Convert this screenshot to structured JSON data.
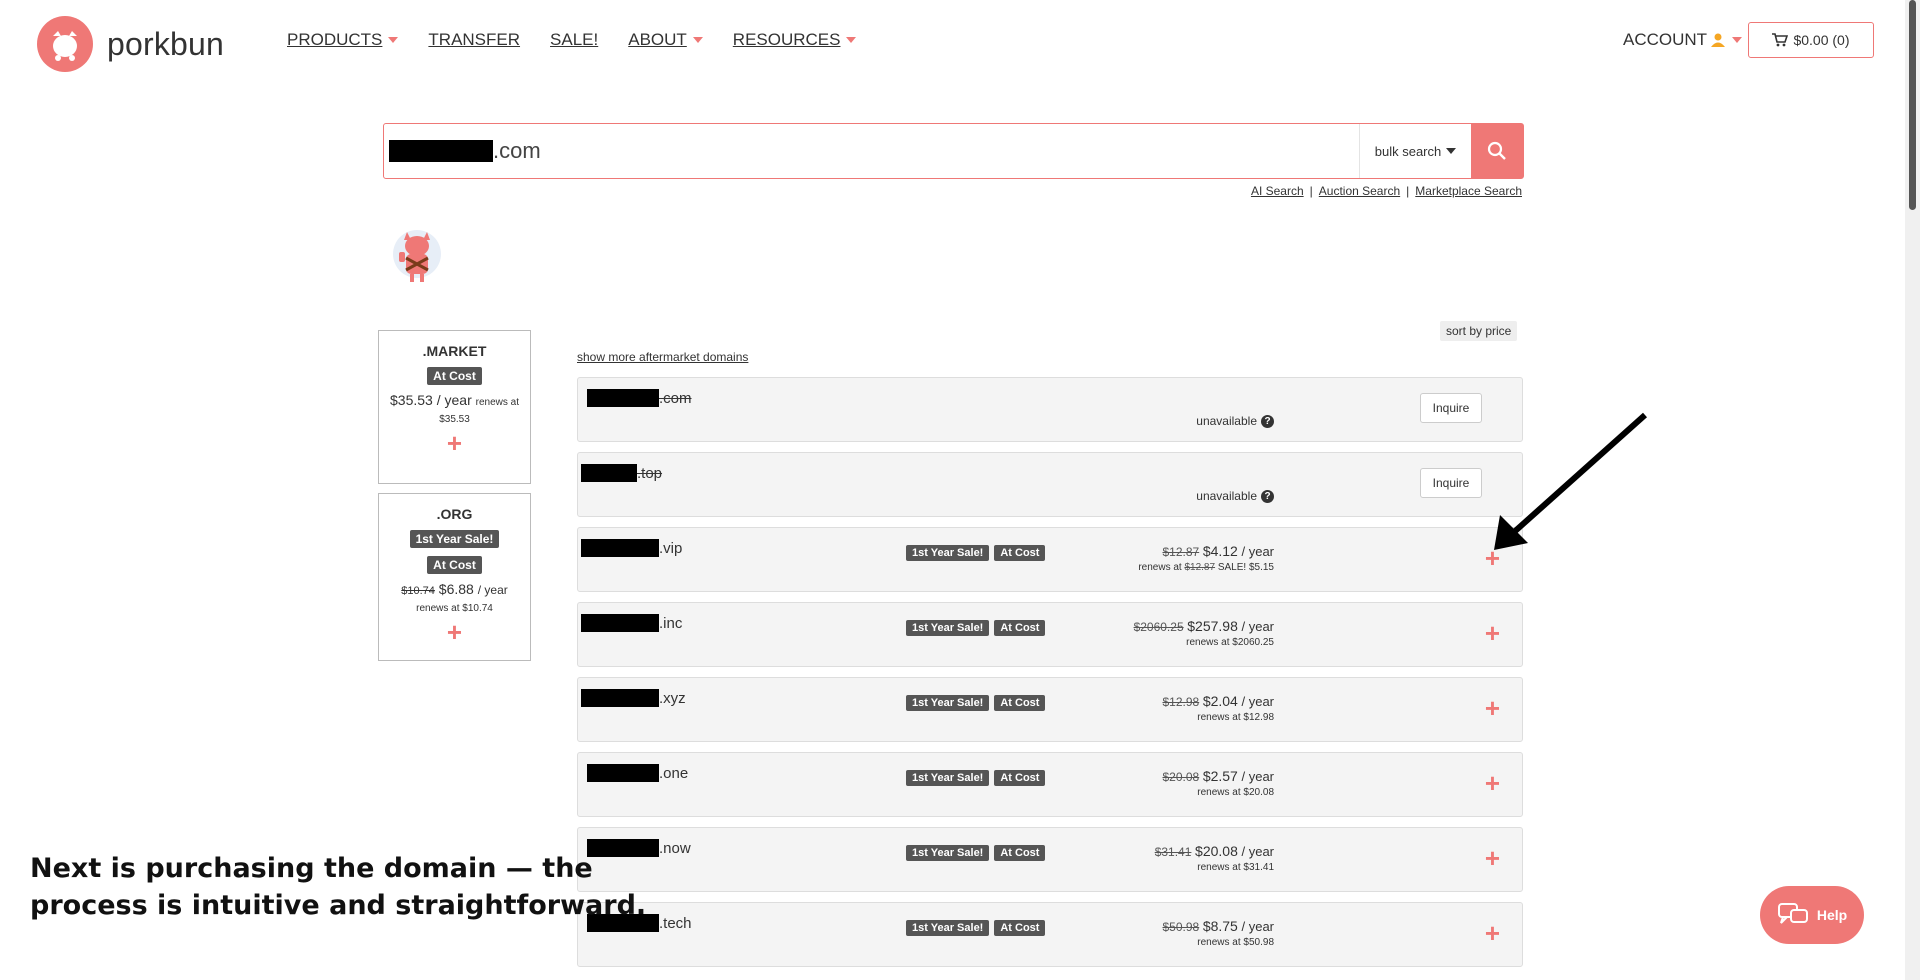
{
  "header": {
    "brand": "porkbun",
    "nav": [
      {
        "label": "PRODUCTS",
        "dropdown": true
      },
      {
        "label": "TRANSFER",
        "dropdown": false
      },
      {
        "label": "SALE!",
        "dropdown": false
      },
      {
        "label": "ABOUT",
        "dropdown": true
      },
      {
        "label": "RESOURCES",
        "dropdown": true
      }
    ],
    "account": "ACCOUNT",
    "cart": "$0.00 (0)"
  },
  "search": {
    "value_suffix": ".com",
    "bulk_label": "bulk search",
    "links": [
      "AI Search",
      "Auction Search",
      "Marketplace Search"
    ]
  },
  "sidebar": [
    {
      "tld": ".MARKET",
      "badges": [
        "At Cost"
      ],
      "price": "$35.53",
      "old": "",
      "per": "/ year",
      "renews": "renews at $35.53"
    },
    {
      "tld": ".ORG",
      "badges": [
        "1st Year Sale!",
        "At Cost"
      ],
      "price": "$6.88",
      "old": "$10.74",
      "per": "/ year",
      "renews": "renews at $10.74"
    }
  ],
  "list": {
    "sort_label": "sort by price",
    "show_more": "show more aftermarket domains",
    "unavailable_text": "unavailable",
    "inquire_label": "Inquire",
    "rows": [
      {
        "tld": ".com",
        "available": false
      },
      {
        "tld": ".top",
        "available": false
      },
      {
        "tld": ".vip",
        "available": true,
        "old": "$12.87",
        "price": "$4.12",
        "per": "/ year",
        "renew_prefix": "renews at",
        "renew_old": "$12.87",
        "renew_text": "SALE! $5.15"
      },
      {
        "tld": ".inc",
        "available": true,
        "old": "$2060.25",
        "price": "$257.98",
        "per": "/ year",
        "renew_prefix": "",
        "renew_old": "",
        "renew_text": "renews at $2060.25"
      },
      {
        "tld": ".xyz",
        "available": true,
        "old": "$12.98",
        "price": "$2.04",
        "per": "/ year",
        "renew_prefix": "",
        "renew_old": "",
        "renew_text": "renews at $12.98"
      },
      {
        "tld": ".one",
        "available": true,
        "old": "$20.08",
        "price": "$2.57",
        "per": "/ year",
        "renew_prefix": "",
        "renew_old": "",
        "renew_text": "renews at $20.08"
      },
      {
        "tld": ".now",
        "available": true,
        "old": "$31.41",
        "price": "$20.08",
        "per": "/ year",
        "renew_prefix": "",
        "renew_old": "",
        "renew_text": "renews at $31.41"
      },
      {
        "tld": ".tech",
        "available": true,
        "old": "$50.98",
        "price": "$8.75",
        "per": "/ year",
        "renew_prefix": "",
        "renew_old": "",
        "renew_text": "renews at $50.98"
      }
    ],
    "row_badges": [
      "1st Year Sale!",
      "At Cost"
    ]
  },
  "overlay": {
    "caption_line1": "Next is purchasing the domain — the",
    "caption_line2": "process is intuitive and straightforward."
  },
  "help_label": "Help",
  "colors": {
    "accent": "#ef7876",
    "badge": "#555555"
  }
}
